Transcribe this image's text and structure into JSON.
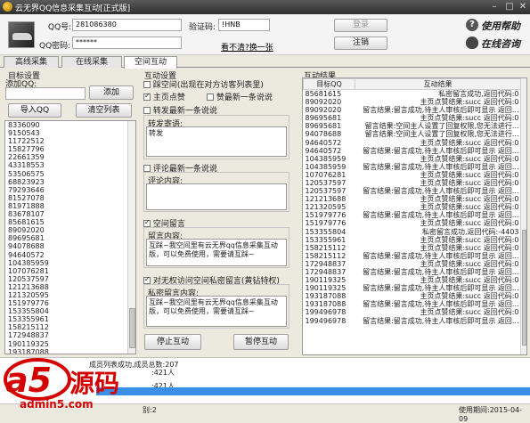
{
  "window": {
    "title": "云无界QQ信息采集互动[正式版]"
  },
  "header": {
    "qq_label": "QQ号:",
    "qq_value": "281086380",
    "pwd_label": "QQ密码:",
    "pwd_value": "******",
    "captcha_label": "验证码:",
    "captcha_value": "!HNB",
    "refresh_link": "看不清?换一张",
    "login_button": "登录",
    "logout_button": "注销",
    "help": "使用帮助",
    "consult": "在线咨询"
  },
  "tabs": [
    "高线采集",
    "在线采集",
    "空间互动"
  ],
  "target": {
    "section": "目标设置",
    "add_label": "添加QQ:",
    "add_value": "",
    "add_button": "添加",
    "import_button": "导入QQ",
    "clear_button": "清空列表",
    "items": [
      "8336090",
      "9150543",
      "11722512",
      "15827796",
      "22661359",
      "43318553",
      "53506575",
      "68823923",
      "79293646",
      "81527078",
      "81971888",
      "83678107",
      "85681615",
      "89092020",
      "89695681",
      "94078688",
      "94640572",
      "104385959",
      "107076281",
      "120537597",
      "121213688",
      "121320595",
      "151979776",
      "153355804",
      "153355961",
      "158215112",
      "172948837",
      "190119325",
      "193187088",
      "199496978"
    ],
    "selected": "199496978"
  },
  "interact": {
    "section": "互动设置",
    "opt1": "踩空间(出现在对方访客列表里)",
    "opt2": "主页点赞",
    "opt3": "赞最新一条说说",
    "opt4": "转发最新一条说说",
    "forward_label": "转发寄语:",
    "forward_text": "转发",
    "opt5": "评论最新一条说说",
    "comment_label": "评论内容:",
    "comment_text": "",
    "opt6": "空间留言",
    "msg_label": "留言内容:",
    "msg_text": "互踩~我空间里有云无界qq信息采集互动版，可以免费使用，需要请互踩~",
    "opt7": "对无权访问空间私密留言(黄钻特权)",
    "priv_label": "私密留言内容:",
    "priv_text": "互踩~我空间里有云无界qq信息采集互动版，可以免费使用，需要请互踩~",
    "stop_button": "停止互动",
    "pause_button": "暂停互动"
  },
  "result": {
    "section": "互动结果",
    "columns": [
      "目标QQ",
      "互动结果"
    ],
    "rows": [
      [
        "85681615",
        "私密留言成功,返回代码:0"
      ],
      [
        "89092020",
        "主页点赞结果:succ 返回代码:0"
      ],
      [
        "89092020",
        "留言结果:留言成功,待主人审核后即可显示 返回..."
      ],
      [
        "89695681",
        "主页点赞结果:succ 返回代码:0"
      ],
      [
        "89695681",
        "留言结果:空间主人设置了回复权限,您无法进行..."
      ],
      [
        "94078688",
        "留言结果:空间主人设置了回复权限,您无法进行..."
      ],
      [
        "94640572",
        "主页点赞结果:succ 返回代码:0"
      ],
      [
        "94640572",
        "留言结果:留言成功,待主人审核后即可显示 返回..."
      ],
      [
        "104385959",
        "主页点赞结果:succ 返回代码:0"
      ],
      [
        "104385959",
        "留言结果:留言成功,待主人审核后即可显示 返回..."
      ],
      [
        "107076281",
        "主页点赞结果:succ 返回代码:0"
      ],
      [
        "120537597",
        "主页点赞结果:succ 返回代码:0"
      ],
      [
        "120537597",
        "留言结果:留言成功,待主人审核后即可显示 返回..."
      ],
      [
        "121213688",
        "主页点赞结果:succ 返回代码:0"
      ],
      [
        "121320595",
        "主页点赞结果:succ 返回代码:0"
      ],
      [
        "151979776",
        "留言结果:留言成功,待主人审核后即可显示 返回..."
      ],
      [
        "151979776",
        "主页点赞结果:succ 返回代码:0"
      ],
      [
        "153355804",
        "私密留言成功,返回代码:-4403"
      ],
      [
        "153355961",
        "主页点赞结果:succ 返回代码:0"
      ],
      [
        "158215112",
        "主页点赞结果:succ 返回代码:0"
      ],
      [
        "158215112",
        "留言结果:留言成功,待主人审核后即可显示 返回..."
      ],
      [
        "172948837",
        "主页点赞结果:succ 返回代码:0"
      ],
      [
        "172948837",
        "留言结果:留言成功,待主人审核后即可显示 返回..."
      ],
      [
        "190119325",
        "主页点赞结果:succ 返回代码:0"
      ],
      [
        "190119325",
        "留言结果:留言成功,待主人审核后即可显示 返回..."
      ],
      [
        "193187088",
        "主页点赞结果:succ 返回代码:0"
      ],
      [
        "193187088",
        "留言结果:留言成功,待主人审核后即可显示 返回..."
      ],
      [
        "199496978",
        "主页点赞结果:succ 返回代码:0"
      ],
      [
        "199496978",
        "留言结果:留言成功,待主人审核后即可显示 返回..."
      ]
    ]
  },
  "log": {
    "line1": "成员列表成功,成员总数:207",
    "line2": ":421人",
    "line3": ":421人",
    "progress": 1.0
  },
  "status": {
    "left": "别:2",
    "right": "使用期间:2015-04-09"
  },
  "watermark": {
    "brand": "a5",
    "cn": "源码",
    "url": "admin5.com"
  }
}
